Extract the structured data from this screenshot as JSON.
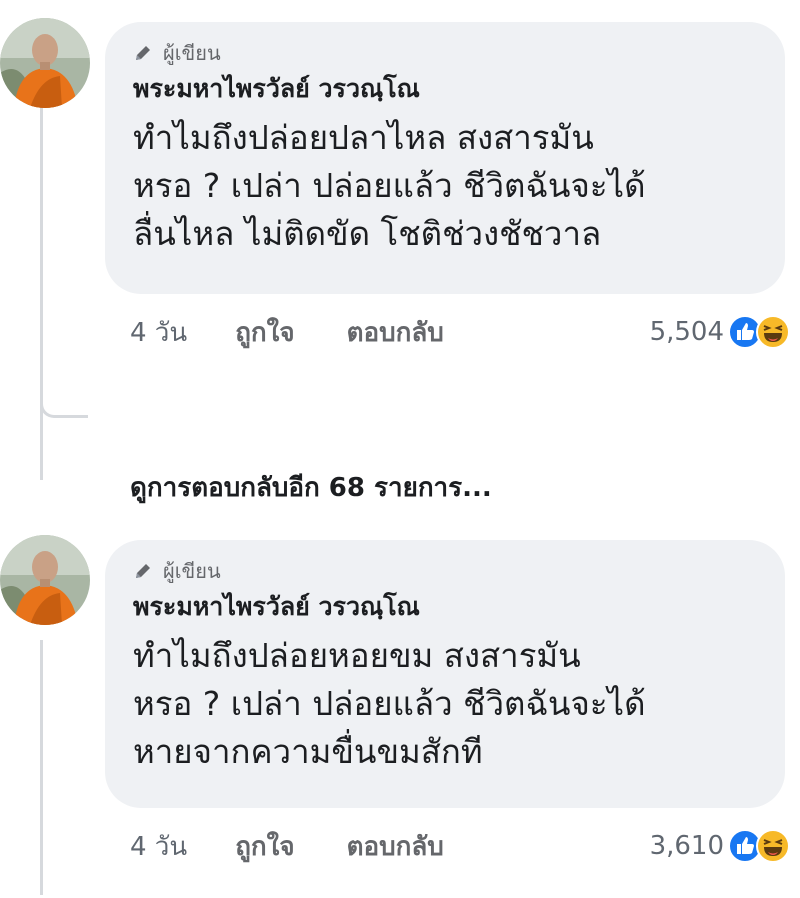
{
  "comments": [
    {
      "badge": "ผู้เขียน",
      "author": "พระมหาไพรวัลย์ วรวณฺโณ",
      "lines": [
        "ทำไมถึงปล่อยปลาไหล สงสารมัน",
        "หรอ ? เปล่า ปล่อยแล้ว ชีวิตฉันจะได้",
        "ลื่นไหล ไม่ติดขัด โชติช่วงชัชวาล"
      ],
      "time": "4 วัน",
      "like": "ถูกใจ",
      "reply": "ตอบกลับ",
      "reaction_count": "5,504",
      "reactions": [
        "like-icon",
        "haha-icon"
      ]
    },
    {
      "badge": "ผู้เขียน",
      "author": "พระมหาไพรวัลย์ วรวณฺโณ",
      "lines": [
        "ทำไมถึงปล่อยหอยขม สงสารมัน",
        "หรอ ? เปล่า ปล่อยแล้ว ชีวิตฉันจะได้",
        "หายจากความขื่นขมสักที"
      ],
      "time": "4 วัน",
      "like": "ถูกใจ",
      "reply": "ตอบกลับ",
      "reaction_count": "3,610",
      "reactions": [
        "like-icon",
        "haha-icon"
      ]
    }
  ],
  "more_replies": "ดูการตอบกลับอีก 68 รายการ...",
  "colors": {
    "bubble": "#eff1f4",
    "like_blue": "#1877f2",
    "haha_yellow": "#f7b928",
    "robe_orange": "#e8731a"
  }
}
